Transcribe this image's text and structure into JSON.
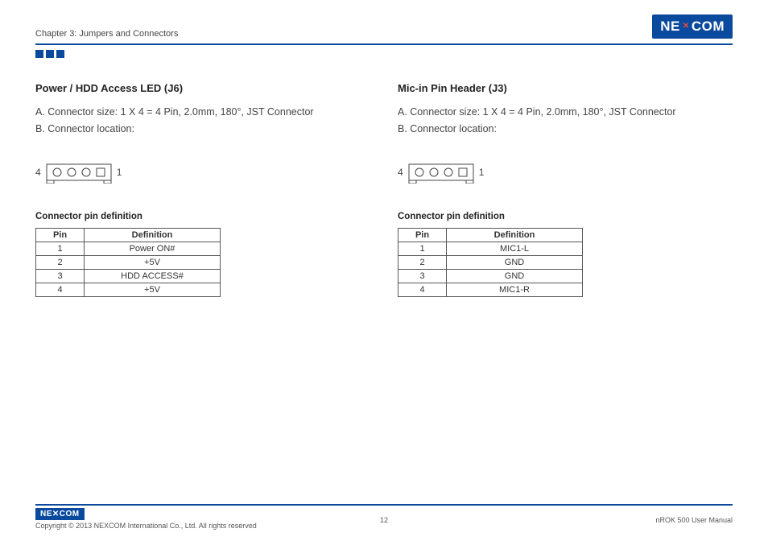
{
  "header": {
    "chapter": "Chapter 3: Jumpers and Connectors",
    "logo_text_pre": "NE",
    "logo_text_post": "COM"
  },
  "left": {
    "title": "Power / HDD Access LED (J6)",
    "lineA": "A. Connector size: 1 X 4 = 4 Pin, 2.0mm, 180°, JST Connector",
    "lineB": "B. Connector location:",
    "pin_left": "4",
    "pin_right": "1",
    "table_title": "Connector pin definition",
    "th_pin": "Pin",
    "th_def": "Definition",
    "rows": [
      {
        "pin": "1",
        "def": "Power ON#"
      },
      {
        "pin": "2",
        "def": "+5V"
      },
      {
        "pin": "3",
        "def": "HDD ACCESS#"
      },
      {
        "pin": "4",
        "def": "+5V"
      }
    ]
  },
  "right": {
    "title": "Mic-in Pin Header (J3)",
    "lineA": "A. Connector size: 1 X 4 = 4 Pin, 2.0mm, 180°, JST Connector",
    "lineB": "B. Connector location:",
    "pin_left": "4",
    "pin_right": "1",
    "table_title": "Connector pin definition",
    "th_pin": "Pin",
    "th_def": "Definition",
    "rows": [
      {
        "pin": "1",
        "def": "MIC1-L"
      },
      {
        "pin": "2",
        "def": "GND"
      },
      {
        "pin": "3",
        "def": "GND"
      },
      {
        "pin": "4",
        "def": "MIC1-R"
      }
    ]
  },
  "footer": {
    "logo": "NE✕COM",
    "copyright": "Copyright © 2013 NEXCOM International Co., Ltd. All rights reserved",
    "page": "12",
    "manual": "nROK 500 User Manual"
  }
}
